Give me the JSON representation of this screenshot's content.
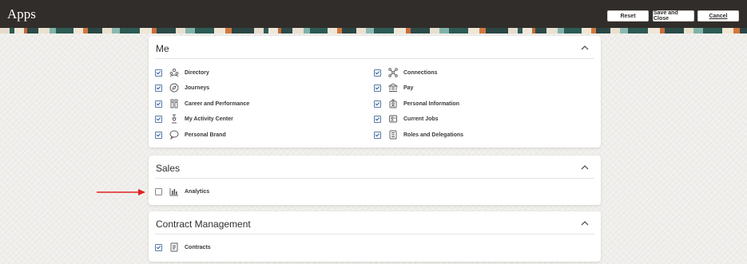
{
  "header": {
    "title": "Apps",
    "reset_label": "Reset",
    "save_close_label": "Save and Close",
    "cancel_label": "Cancel"
  },
  "sections": {
    "me": {
      "title": "Me",
      "left": [
        {
          "label": "Directory",
          "checked": true,
          "icon": "people-group-icon"
        },
        {
          "label": "Journeys",
          "checked": true,
          "icon": "compass-icon"
        },
        {
          "label": "Career and Performance",
          "checked": true,
          "icon": "trophy-icon"
        },
        {
          "label": "My Activity Center",
          "checked": true,
          "icon": "activity-icon"
        },
        {
          "label": "Personal Brand",
          "checked": true,
          "icon": "speech-icon"
        }
      ],
      "right": [
        {
          "label": "Connections",
          "checked": true,
          "icon": "network-icon"
        },
        {
          "label": "Pay",
          "checked": true,
          "icon": "bank-icon"
        },
        {
          "label": "Personal Information",
          "checked": true,
          "icon": "id-badge-icon"
        },
        {
          "label": "Current Jobs",
          "checked": true,
          "icon": "job-icon"
        },
        {
          "label": "Roles and Delegations",
          "checked": true,
          "icon": "document-list-icon"
        }
      ]
    },
    "sales": {
      "title": "Sales",
      "items": [
        {
          "label": "Analytics",
          "checked": false,
          "icon": "analytics-icon"
        }
      ]
    },
    "contract_management": {
      "title": "Contract Management",
      "items": [
        {
          "label": "Contracts",
          "checked": true,
          "icon": "contract-scroll-icon"
        }
      ]
    }
  },
  "colors": {
    "header_bg": "#312d2a",
    "check": "#2b5e9e",
    "annotation_arrow": "#e02020"
  }
}
